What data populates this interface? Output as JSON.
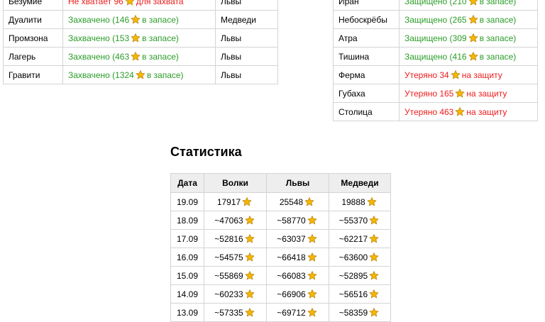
{
  "colors": {
    "captured": "#2a9d28",
    "lost": "#ee1c1c",
    "header_bg": "#eeeeee",
    "border": "#d4d4d4",
    "star": "#f5b800"
  },
  "icons": {
    "star": "star-icon"
  },
  "left_territories": [
    {
      "name": "Безумие",
      "status_pre": "Не хватает 96",
      "status_post": "для захвата",
      "state": "red",
      "owner": "Львы"
    },
    {
      "name": "Дуалити",
      "status_pre": "Захвачено (146",
      "status_post": "в запасе)",
      "state": "green",
      "owner": "Медведи"
    },
    {
      "name": "Промзона",
      "status_pre": "Захвачено (153",
      "status_post": "в запасе)",
      "state": "green",
      "owner": "Львы"
    },
    {
      "name": "Лагерь",
      "status_pre": "Захвачено (463",
      "status_post": "в запасе)",
      "state": "green",
      "owner": "Львы"
    },
    {
      "name": "Гравити",
      "status_pre": "Захвачено (1324",
      "status_post": "в запасе)",
      "state": "green",
      "owner": "Львы"
    }
  ],
  "right_territories": [
    {
      "name": "Иран",
      "status_pre": "Защищено (210",
      "status_post": "в запасе)",
      "state": "green"
    },
    {
      "name": "Небоскрёбы",
      "status_pre": "Защищено (265",
      "status_post": "в запасе)",
      "state": "green"
    },
    {
      "name": "Атра",
      "status_pre": "Защищено (309",
      "status_post": "в запасе)",
      "state": "green"
    },
    {
      "name": "Тишина",
      "status_pre": "Защищено (416",
      "status_post": "в запасе)",
      "state": "green"
    },
    {
      "name": "Ферма",
      "status_pre": "Утеряно 34",
      "status_post": "на защиту",
      "state": "red"
    },
    {
      "name": "Губаха",
      "status_pre": "Утеряно 165",
      "status_post": "на защиту",
      "state": "red"
    },
    {
      "name": "Столица",
      "status_pre": "Утеряно 463",
      "status_post": "на защиту",
      "state": "red"
    }
  ],
  "stats": {
    "title": "Статистика",
    "headers": [
      "Дата",
      "Волки",
      "Львы",
      "Медведи"
    ],
    "rows": [
      [
        "19.09",
        "17917",
        "25548",
        "19888"
      ],
      [
        "18.09",
        "~47063",
        "~58770",
        "~55370"
      ],
      [
        "17.09",
        "~52816",
        "~63037",
        "~62217"
      ],
      [
        "16.09",
        "~54575",
        "~66418",
        "~63600"
      ],
      [
        "15.09",
        "~55869",
        "~66083",
        "~52895"
      ],
      [
        "14.09",
        "~60233",
        "~66906",
        "~56516"
      ],
      [
        "13.09",
        "~57335",
        "~69712",
        "~58359"
      ]
    ]
  }
}
